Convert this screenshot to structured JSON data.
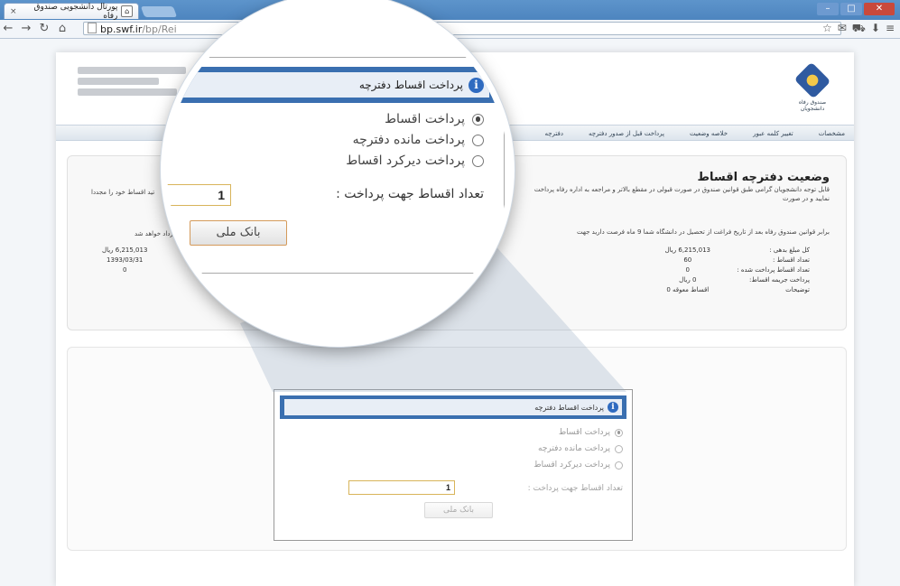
{
  "browser": {
    "tab_title": "پورتال دانشجویی صندوق رفاه",
    "tab_close": "×",
    "url_host": "bp.swf.ir",
    "url_path": "/bp/Rei",
    "nav_icons": [
      "back-icon",
      "forward-icon",
      "reload-icon",
      "home-icon"
    ],
    "window_buttons": [
      "minimize",
      "maximize",
      "close"
    ]
  },
  "header": {
    "logo_caption": "صندوق رفاه دانشجویان"
  },
  "menu": {
    "items": [
      "مشخصات",
      "تغییر کلمه عبور",
      "خلاصه وضعیت",
      "پرداخت قبل از صدور دفترچه",
      "دفترچه"
    ]
  },
  "status_panel": {
    "title": "وضعیت دفترچه اقساط",
    "desc": "قابل توجه دانشجویان گرامی طبق قوانین صندوق در صورت قبولی در مقطع بالاتر و مراجعه به اداره رفاه پرداخت نمایید و در صورت",
    "rule_line": "برابر قوانین صندوق رفاه بعد از تاریخ فراغت از تحصیل در دانشگاه شما 9 ماه فرصت دارید جهت",
    "left_note": "تید اقساط خود را مجددا",
    "left_note2": "سترداد خواهد شد",
    "labels": [
      "کل مبلغ بدهی :",
      "تعداد اقساط :",
      "تعداد اقساط پرداخت شده :",
      "پرداخت جریمه اقساط:",
      "توضیحات"
    ],
    "values": [
      "6,215,013 ریال",
      "60",
      "0",
      "0 ریال",
      "اقساط معوقه 0"
    ],
    "left_values": [
      "6,215,013 ریال",
      "1393/03/31",
      "0"
    ]
  },
  "dialog": {
    "title": "پرداخت اقساط دفترچه",
    "info_glyph": "i",
    "options": [
      {
        "label": "پرداخت اقساط",
        "selected": true
      },
      {
        "label": "پرداخت مانده دفترچه",
        "selected": false
      },
      {
        "label": "پرداخت دیرکرد اقساط",
        "selected": false
      }
    ],
    "count_label": "تعداد اقساط جهت پرداخت :",
    "count_value": "1",
    "bank_button": "بانک ملی"
  },
  "colors": {
    "accent": "#3a6fb0",
    "header_fill": "#e8eef6",
    "input_border": "#d8b45a"
  }
}
